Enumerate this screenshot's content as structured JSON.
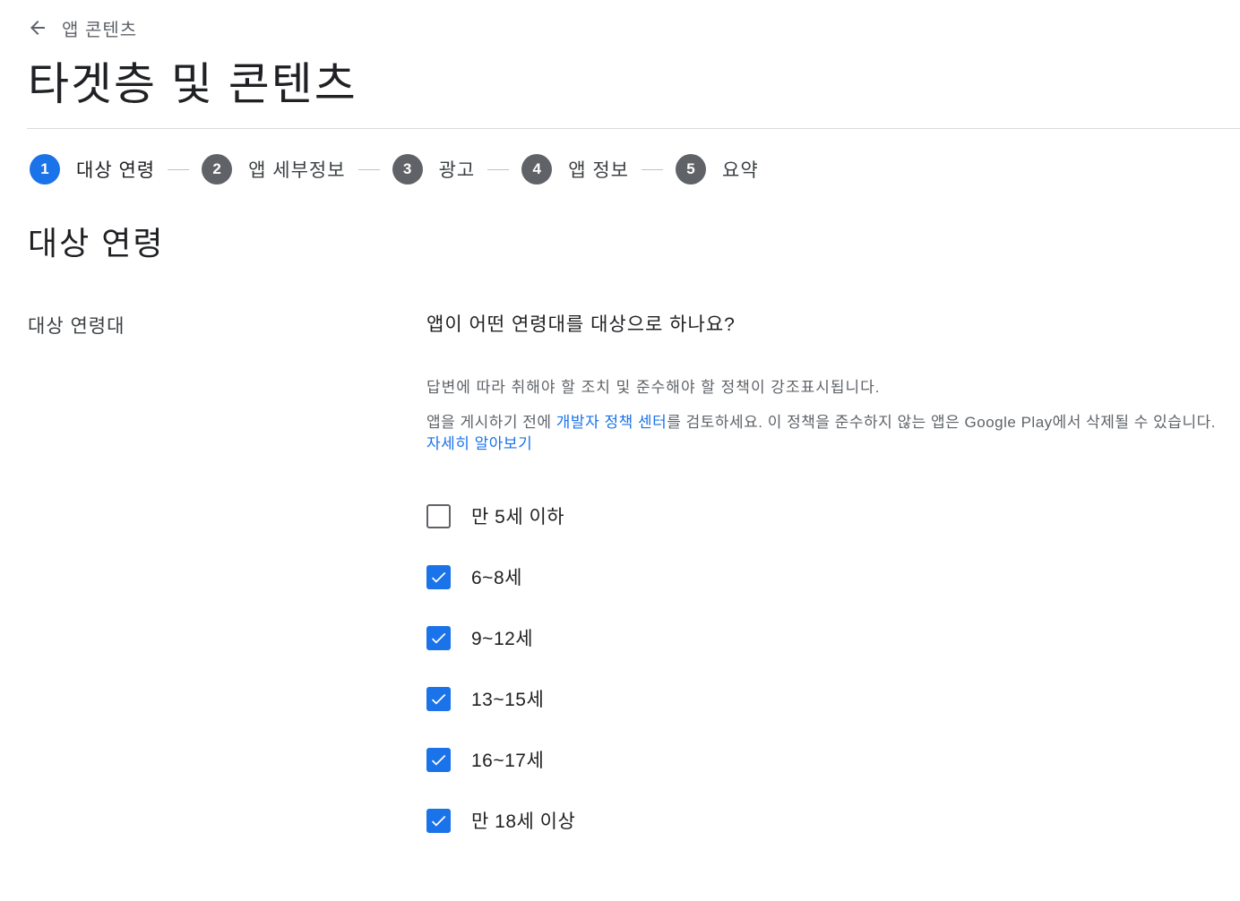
{
  "header": {
    "back_label": "앱 콘텐츠",
    "title": "타겟층 및 콘텐츠"
  },
  "stepper": {
    "steps": [
      {
        "number": "1",
        "label": "대상 연령",
        "active": true
      },
      {
        "number": "2",
        "label": "앱 세부정보",
        "active": false
      },
      {
        "number": "3",
        "label": "광고",
        "active": false
      },
      {
        "number": "4",
        "label": "앱 정보",
        "active": false
      },
      {
        "number": "5",
        "label": "요약",
        "active": false
      }
    ]
  },
  "section": {
    "title": "대상 연령",
    "field_label": "대상 연령대",
    "question": "앱이 어떤 연령대를 대상으로 하나요?",
    "help_text": "답변에 따라 취해야 할 조치 및 준수해야 할 정책이 강조표시됩니다.",
    "notice": {
      "part1": "앱을 게시하기 전에 ",
      "link1": "개발자 정책 센터",
      "part2": "를 검토하세요. 이 정책을 준수하지 않는 앱은 Google Play에서 삭제될 수 있습니다. ",
      "link2": "자세히 알아보기"
    }
  },
  "options": [
    {
      "label": "만 5세 이하",
      "checked": false
    },
    {
      "label": "6~8세",
      "checked": true
    },
    {
      "label": "9~12세",
      "checked": true
    },
    {
      "label": "13~15세",
      "checked": true
    },
    {
      "label": "16~17세",
      "checked": true
    },
    {
      "label": "만 18세 이상",
      "checked": true
    }
  ],
  "colors": {
    "accent": "#1a73e8",
    "step_inactive": "#5f6368",
    "divider": "#dadce0"
  },
  "icons": {
    "back": "arrow-left-icon",
    "check": "check-icon"
  }
}
